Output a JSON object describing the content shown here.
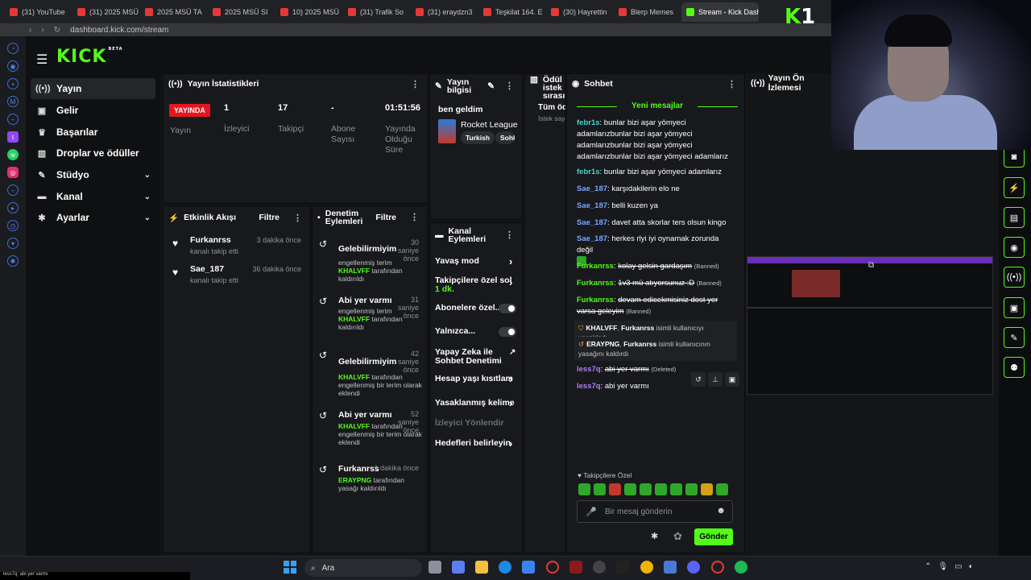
{
  "browser": {
    "tabs": [
      "(31) YouTube",
      "(31) 2025 MSÜ",
      "2025 MSÜ TA",
      "2025 MSÜ SI",
      "10) 2025 MSÜ",
      "(31) Trafik So",
      "(31) eraydzn3",
      "Teşkilat 164. E",
      "(30) Hayrettin",
      "Blerp Memes",
      "Stream - Kick Dashb"
    ],
    "url": "dashboard.kick.com/stream",
    "url_host": "kick.com"
  },
  "kick": {
    "logo": "KICK",
    "logo_tag": "BETA"
  },
  "nav": [
    {
      "label": "Yayın",
      "icon": "broadcast-icon",
      "active": true
    },
    {
      "label": "Gelir",
      "icon": "revenue-icon"
    },
    {
      "label": "Başarılar",
      "icon": "trophy-icon"
    },
    {
      "label": "Droplar ve ödüller",
      "icon": "gift-icon"
    },
    {
      "label": "Stüdyo",
      "icon": "studio-icon",
      "chevron": true
    },
    {
      "label": "Kanal",
      "icon": "channel-icon",
      "chevron": true
    },
    {
      "label": "Ayarlar",
      "icon": "settings-icon",
      "chevron": true
    }
  ],
  "stats": {
    "title": "Yayın İstatistikleri",
    "live": "YAYINDA",
    "stream_label": "Yayın",
    "viewers": "1",
    "viewers_label": "İzleyici",
    "followers": "17",
    "followers_label": "Takipçi",
    "subs": "-",
    "subs_label": "Abone Sayısı",
    "duration": "01:51:56",
    "duration_label": "Yayında Olduğu Süre"
  },
  "activity": {
    "title": "Etkinlik Akışı",
    "filter": "Filtre",
    "items": [
      {
        "name": "Furkanrss",
        "sub": "kanalı takip etti",
        "time": "3 dakika önce"
      },
      {
        "name": "Sae_187",
        "sub": "kanalı takip etti",
        "time": "36 dakika önce"
      }
    ]
  },
  "moderation": {
    "title": "Denetim Eylemleri",
    "filter": "Filtre",
    "items": [
      {
        "name": "Gelebilirmiyim",
        "time": "30 saniye önce",
        "d1": "engellenmiş terim",
        "who": "KHALVFF",
        "d2": "tarafından kaldırıldı"
      },
      {
        "name": "Abi yer varmı",
        "time": "31 saniye önce",
        "d1": "engellenmiş terim",
        "who": "KHALVFF",
        "d2": "tarafından kaldırıldı"
      },
      {
        "name": "Gelebilirmiyim",
        "time": "42 saniye önce",
        "d1": "",
        "who": "KHALVFF",
        "d2": "tarafından engellenmiş bir terim olarak eklendi"
      },
      {
        "name": "Abi yer varmı",
        "time": "52 saniye önce",
        "d1": "",
        "who": "KHALVFF",
        "d2": "tarafından engellenmiş bir terim olarak eklendi"
      },
      {
        "name": "Furkanrss",
        "time": "1 dakika önce",
        "d1": "",
        "who": "ERAYPNG",
        "d2": "tarafından yasağı kaldırıldı"
      }
    ]
  },
  "stream_info": {
    "title": "Yayın bilgisi",
    "stream_title": "ben geldim",
    "game": "Rocket League",
    "tags": [
      "Turkish",
      "Sohb"
    ]
  },
  "queue": {
    "title": "Ödül istek sırası",
    "all": "Tüm öd",
    "sub": "İstek say"
  },
  "channel_actions": {
    "title": "Kanal Eylemleri",
    "items": [
      "Yavaş mod",
      "Takipçilere özel sol",
      "Abonelere özel...",
      "Yalnızca...",
      "Yapay Zeka ile Sohbet Denetimi",
      "Hesap yaşı kısıtlam",
      "Yasaklanmış kelime",
      "İzleyici Yönlendir",
      "Hedefleri belirleyin"
    ],
    "sub_1": "1 dk."
  },
  "chat": {
    "title": "Sohbet",
    "new_label": "Yeni mesajlar",
    "messages": [
      {
        "user": "febr1s",
        "text": "bunlar bizi aşar yömyeci adamlarızbunlar bizi aşar yömyeci adamlarızbunlar bizi aşar yömyeci adamlarızbunlar bizi aşar yömyeci adamlarız"
      },
      {
        "user": "febr1s",
        "text": "bunlar bizi aşar yömyeci adamlarız"
      },
      {
        "user": "Sae_187",
        "text": "karşıdakilerin elo ne"
      },
      {
        "user": "Sae_187",
        "text": "belli kuzen ya"
      },
      {
        "user": "Sae_187",
        "text": "davet atta skorlar ters olsun kingo"
      },
      {
        "user": "Sae_187",
        "text": "herkes rlyi iyi oynamak zorunda değil"
      },
      {
        "user": "Furkanrss",
        "text": "kolay gelsin gardaşım",
        "tag": "(Banned)"
      },
      {
        "user": "Furkanrss",
        "text": "1v3 mü atıyorsunuz :D",
        "tag": "(Banned)"
      },
      {
        "user": "Furkanrss",
        "text": "devam edicekmisiniz dost yer varsa geleyim",
        "tag": "(Banned)"
      },
      {
        "user": "less7q",
        "text": "abi yer varmı",
        "tag": "(Deleted)"
      },
      {
        "user": "less7q",
        "text": "abi yer varmı"
      }
    ],
    "sys1": {
      "mod": "KHALVFF",
      "target": "Furkanrss",
      "text": "isimli kullanıcıyı yasakladı"
    },
    "sys2": {
      "mod": "ERAYPNG",
      "target": "Furkanrss",
      "text": "isimli kullanıcının yasağını kaldırdı"
    },
    "followers_only": "Takipçilere Özel",
    "placeholder": "Bir mesaj gönderin",
    "send": "Gönder"
  },
  "preview": {
    "title": "Yayın Ön İzlemesi"
  },
  "overlay": {
    "brand": "K",
    "num": "1"
  },
  "taskbar": {
    "search": "Ara"
  },
  "ticker": "less7q: abi yer varmı",
  "colors": {
    "accent": "#53fc18",
    "live": "#e5161d"
  }
}
